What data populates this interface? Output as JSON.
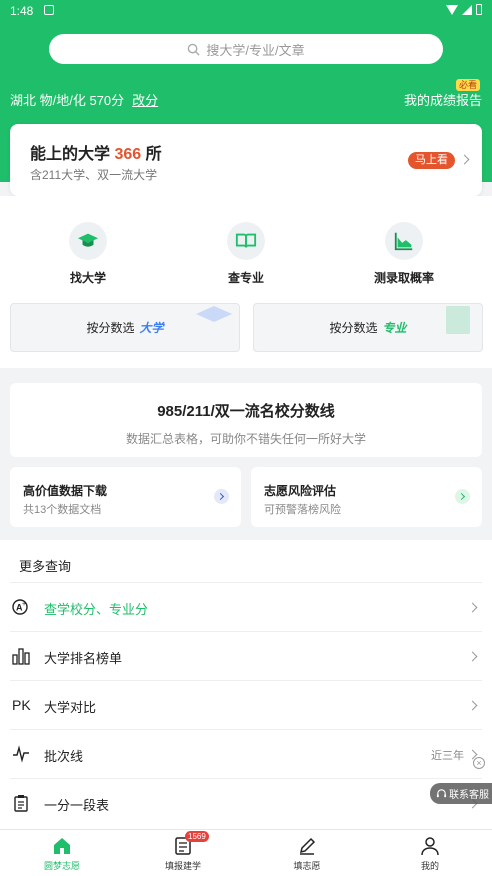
{
  "status_bar": {
    "time": "1:48"
  },
  "search": {
    "placeholder": "搜大学/专业/文章"
  },
  "profile": {
    "location_subjects_score": "湖北 物/地/化 570分",
    "change_label": "改分"
  },
  "report": {
    "label": "我的成绩报告",
    "badge": "必看"
  },
  "can_reach": {
    "title_prefix": "能上的大学",
    "count": "366",
    "title_suffix": "所",
    "subtitle": "含211大学、双一流大学",
    "action": "马上看"
  },
  "tools": [
    {
      "label": "找大学",
      "icon": "graduation-cap-icon"
    },
    {
      "label": "查专业",
      "icon": "open-book-icon"
    },
    {
      "label": "测录取概率",
      "icon": "area-chart-icon"
    }
  ],
  "pickers": [
    {
      "prefix": "按分数选",
      "emphasis": "大学",
      "emphasis_color": "#3b7ef5"
    },
    {
      "prefix": "按分数选",
      "emphasis": "专业",
      "emphasis_color": "#1fbe6a"
    }
  ],
  "score_line": {
    "title": "985/211/双一流名校分数线",
    "subtitle": "数据汇总表格，可助你不错失任何一所好大学"
  },
  "mini_cards": [
    {
      "title": "高价值数据下载",
      "subtitle": "共13个数据文档",
      "accent": "#3b5bdb"
    },
    {
      "title": "志愿风险评估",
      "subtitle": "可预警落榜风险",
      "accent": "#1fbe6a"
    }
  ],
  "more": {
    "title": "更多查询",
    "items": [
      {
        "label": "查学校分、专业分",
        "icon": "score-search-icon",
        "highlight": true,
        "extra": ""
      },
      {
        "label": "大学排名榜单",
        "icon": "ranking-bars-icon",
        "highlight": false,
        "extra": ""
      },
      {
        "label": "大学对比",
        "icon": "pk-icon",
        "icon_text": "PK",
        "highlight": false,
        "extra": ""
      },
      {
        "label": "批次线",
        "icon": "pulse-line-icon",
        "highlight": false,
        "extra": "近三年"
      },
      {
        "label": "一分一段表",
        "icon": "clipboard-icon",
        "highlight": false,
        "extra": ""
      }
    ]
  },
  "service": {
    "label": "联系客服"
  },
  "tabs": [
    {
      "label": "圆梦志愿",
      "icon": "home-icon",
      "active": true,
      "badge": ""
    },
    {
      "label": "填报建学",
      "icon": "document-icon",
      "active": false,
      "badge": "1569"
    },
    {
      "label": "填志愿",
      "icon": "pen-icon",
      "active": false,
      "badge": ""
    },
    {
      "label": "我的",
      "icon": "user-icon",
      "active": false,
      "badge": ""
    }
  ],
  "colors": {
    "brand": "#1fbe6a",
    "accent_red": "#e4552d",
    "badge_yellow": "#ffd94a"
  }
}
